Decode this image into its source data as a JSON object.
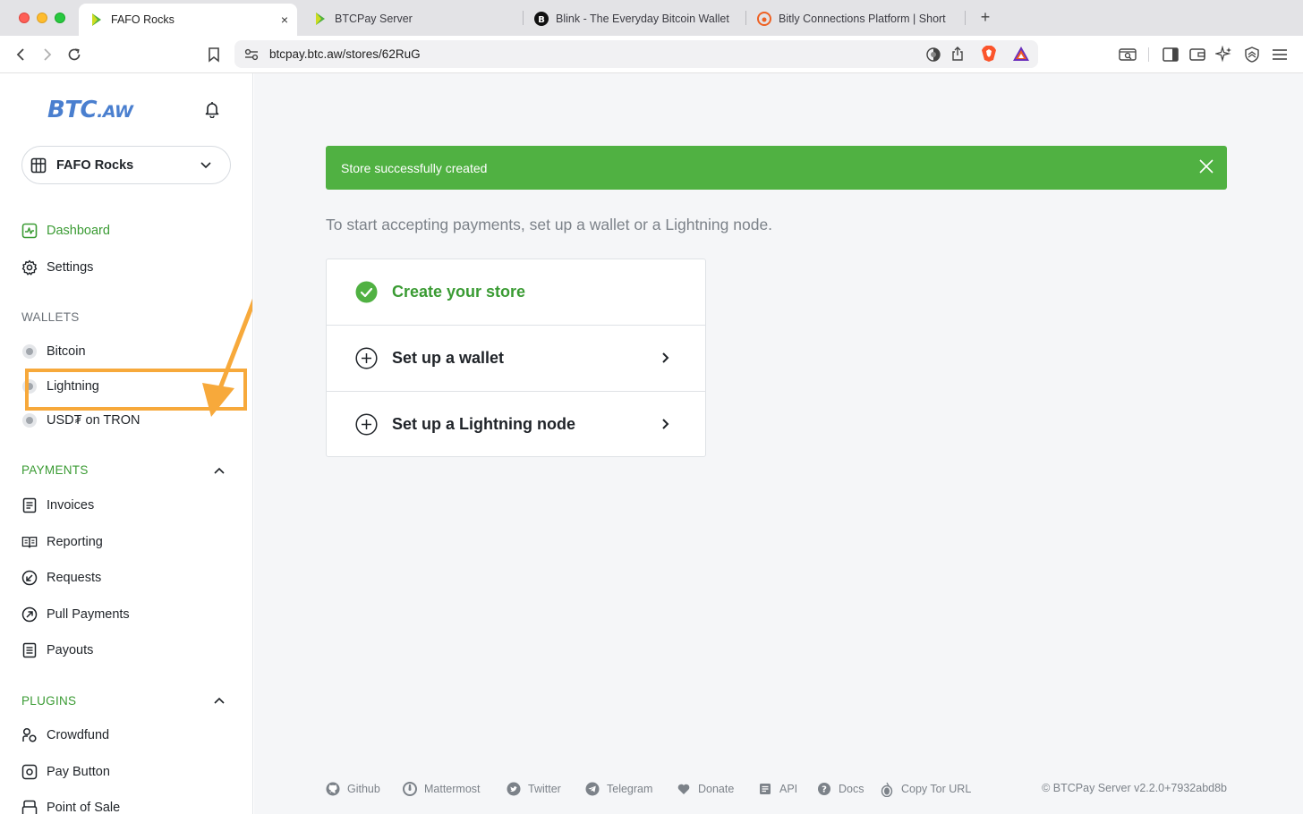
{
  "browser": {
    "tabs": [
      {
        "title": "FAFO Rocks",
        "active": true,
        "icon": "btcpay-favicon"
      },
      {
        "title": "BTCPay Server",
        "active": false,
        "icon": "btcpay-favicon"
      },
      {
        "title": "Blink - The Everyday Bitcoin Wallet",
        "active": false,
        "icon": "blink-favicon"
      },
      {
        "title": "Bitly Connections Platform | Short",
        "active": false,
        "icon": "bitly-favicon"
      }
    ],
    "close_tab_symbol": "×",
    "new_tab_symbol": "+",
    "url": "btcpay.btc.aw/stores/62RuG"
  },
  "sidebar": {
    "logo_main": "BTC",
    "logo_suffix": ".AW",
    "store_name": "FAFO Rocks",
    "nav_top": [
      {
        "label": "Dashboard",
        "icon": "dashboard-icon",
        "active": true
      },
      {
        "label": "Settings",
        "icon": "gear-icon",
        "active": false
      }
    ],
    "wallets_heading": "WALLETS",
    "wallets": [
      {
        "label": "Bitcoin"
      },
      {
        "label": "Lightning"
      },
      {
        "label": "USD₮ on TRON"
      }
    ],
    "payments_heading": "PAYMENTS",
    "payments": [
      {
        "label": "Invoices",
        "icon": "invoice-icon"
      },
      {
        "label": "Reporting",
        "icon": "reporting-icon"
      },
      {
        "label": "Requests",
        "icon": "requests-icon"
      },
      {
        "label": "Pull Payments",
        "icon": "pull-payments-icon"
      },
      {
        "label": "Payouts",
        "icon": "payouts-icon"
      }
    ],
    "plugins_heading": "PLUGINS",
    "plugins": [
      {
        "label": "Crowdfund",
        "icon": "crowdfund-icon"
      },
      {
        "label": "Pay Button",
        "icon": "pay-button-icon"
      },
      {
        "label": "Point of Sale",
        "icon": "point-of-sale-icon"
      }
    ]
  },
  "main": {
    "alert": "Store successfully created",
    "intro": "To start accepting payments, set up a wallet or a Lightning node.",
    "steps": [
      {
        "label": "Create your store",
        "done": true
      },
      {
        "label": "Set up a wallet",
        "done": false
      },
      {
        "label": "Set up a Lightning node",
        "done": false
      }
    ]
  },
  "footer": {
    "links": [
      {
        "label": "Github",
        "icon": "github-icon"
      },
      {
        "label": "Mattermost",
        "icon": "mattermost-icon"
      },
      {
        "label": "Twitter",
        "icon": "twitter-icon"
      },
      {
        "label": "Telegram",
        "icon": "telegram-icon"
      },
      {
        "label": "Donate",
        "icon": "heart-icon"
      },
      {
        "label": "API",
        "icon": "api-icon"
      },
      {
        "label": "Docs",
        "icon": "docs-icon"
      },
      {
        "label": "Copy Tor URL",
        "icon": "tor-icon"
      }
    ],
    "copyright": "© BTCPay Server v2.2.0+7932abd8b"
  },
  "colors": {
    "brand_green": "#50b142",
    "nav_active_green": "#3a9b33",
    "logo_blue": "#4a7fcf",
    "annotation_orange": "#f7a93b"
  }
}
